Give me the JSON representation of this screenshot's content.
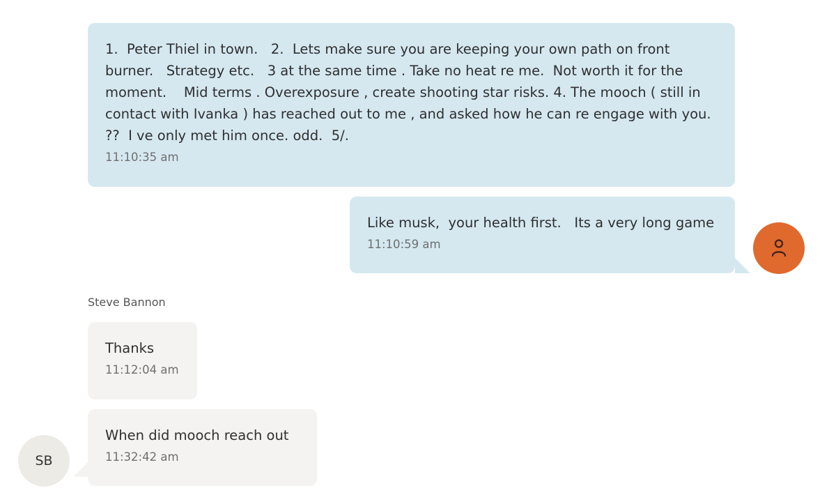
{
  "messages": [
    {
      "direction": "outgoing",
      "text": "1.  Peter Thiel in town.   2.  Lets make sure you are keeping your own path on front burner.   Strategy etc.   3 at the same time . Take no heat re me.  Not worth it for the moment.    Mid terms . Overexposure , create shooting star risks. 4. The mooch ( still in contact with Ivanka ) has reached out to me , and asked how he can re engage with you. ??  I ve only met him once. odd.  5/.",
      "time": "11:10:35 am"
    },
    {
      "direction": "outgoing",
      "text": "Like musk,  your health first.   Its a very long game",
      "time": "11:10:59 am"
    },
    {
      "direction": "incoming",
      "text": "Thanks",
      "time": "11:12:04 am"
    },
    {
      "direction": "incoming",
      "text": "When did mooch reach out",
      "time": "11:32:42 am"
    }
  ],
  "sender": {
    "name": "Steve Bannon",
    "initials": "SB"
  },
  "me": {
    "avatar_icon": "user-icon"
  },
  "colors": {
    "outgoing_bubble": "#d5e8f0",
    "incoming_bubble": "#f4f3f2",
    "my_avatar": "#e0692d",
    "sender_avatar": "#ecebe5"
  }
}
